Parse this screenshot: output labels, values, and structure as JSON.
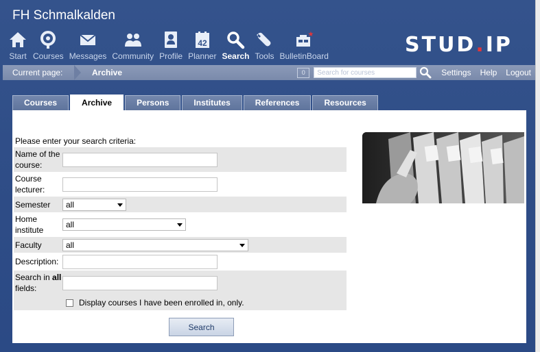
{
  "site": {
    "title": "FH Schmalkalden",
    "logo_main": "STUD",
    "logo_dot": ".",
    "logo_tail": "IP"
  },
  "nav": [
    {
      "label": "Start",
      "icon": "house-icon"
    },
    {
      "label": "Courses",
      "icon": "courses-icon"
    },
    {
      "label": "Messages",
      "icon": "envelope-icon"
    },
    {
      "label": "Community",
      "icon": "people-icon"
    },
    {
      "label": "Profile",
      "icon": "profile-icon"
    },
    {
      "label": "Planner",
      "icon": "calendar-icon",
      "badge": "42"
    },
    {
      "label": "Search",
      "icon": "search-icon",
      "active": true
    },
    {
      "label": "Tools",
      "icon": "wrench-icon"
    },
    {
      "label": "BulletinBoard",
      "icon": "bulletinboard-icon"
    }
  ],
  "breadcrumb": {
    "label": "Current page:",
    "current": "Archive",
    "count": "0",
    "search_placeholder": "Search for courses",
    "links": [
      "Settings",
      "Help",
      "Logout"
    ]
  },
  "tabs": [
    {
      "label": "Courses"
    },
    {
      "label": "Archive",
      "active": true
    },
    {
      "label": "Persons"
    },
    {
      "label": "Institutes"
    },
    {
      "label": "References"
    },
    {
      "label": "Resources"
    }
  ],
  "form": {
    "intro": "Please enter your search criteria:",
    "name_label": "Name of the course:",
    "lecturer_label": "Course lecturer:",
    "semester_label": "Semester",
    "semester_value": "all",
    "institute_label": "Home institute",
    "institute_value": "all",
    "faculty_label": "Faculty",
    "faculty_value": "all",
    "description_label": "Description:",
    "allfields_label_a": "Search in ",
    "allfields_label_b": "all",
    "allfields_label_c": " fields:",
    "checkbox_label": "Display courses I have been enrolled in, only.",
    "search_button": "Search"
  },
  "colors": {
    "accent": "#2e4c86",
    "logo_dot": "#e0363a"
  }
}
